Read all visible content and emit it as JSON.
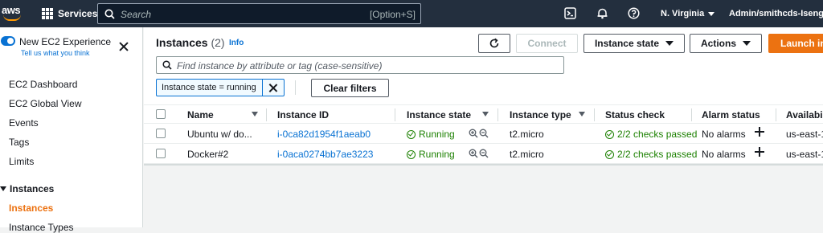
{
  "topnav": {
    "logo_text": "aws",
    "services_label": "Services",
    "search_placeholder": "Search",
    "search_shortcut": "[Option+S]",
    "icons": [
      "cloudshell-icon",
      "bell-icon",
      "help-icon"
    ],
    "region": "N. Virginia",
    "account": "Admin/smithcds-Isengard"
  },
  "sidebar": {
    "new_experience": "New EC2 Experience",
    "tell_us": "Tell us what you think",
    "items": [
      "EC2 Dashboard",
      "EC2 Global View",
      "Events",
      "Tags",
      "Limits"
    ],
    "section": "Instances",
    "section_items": [
      "Instances",
      "Instance Types"
    ]
  },
  "header": {
    "title": "Instances",
    "count": "(2)",
    "info": "Info",
    "connect": "Connect",
    "instance_state": "Instance state",
    "actions": "Actions",
    "launch": "Launch in"
  },
  "filter": {
    "placeholder": "Find instance by attribute or tag (case-sensitive)",
    "token": "Instance state = running",
    "clear": "Clear filters"
  },
  "table": {
    "columns": [
      "Name",
      "Instance ID",
      "Instance state",
      "Instance type",
      "Status check",
      "Alarm status",
      "Availabi"
    ],
    "rows": [
      {
        "name": "Ubuntu w/ do...",
        "id": "i-0ca82d1954f1aeab0",
        "state": "Running",
        "type": "t2.micro",
        "status": "2/2 checks passed",
        "alarm": "No alarms",
        "az": "us-east-1"
      },
      {
        "name": "Docker#2",
        "id": "i-0aca0274bb7ae3223",
        "state": "Running",
        "type": "t2.micro",
        "status": "2/2 checks passed",
        "alarm": "No alarms",
        "az": "us-east-1"
      }
    ]
  },
  "colors": {
    "nav": "#232f3e",
    "accent": "#ec7211",
    "link": "#0972d3",
    "ok": "#1d8102"
  }
}
